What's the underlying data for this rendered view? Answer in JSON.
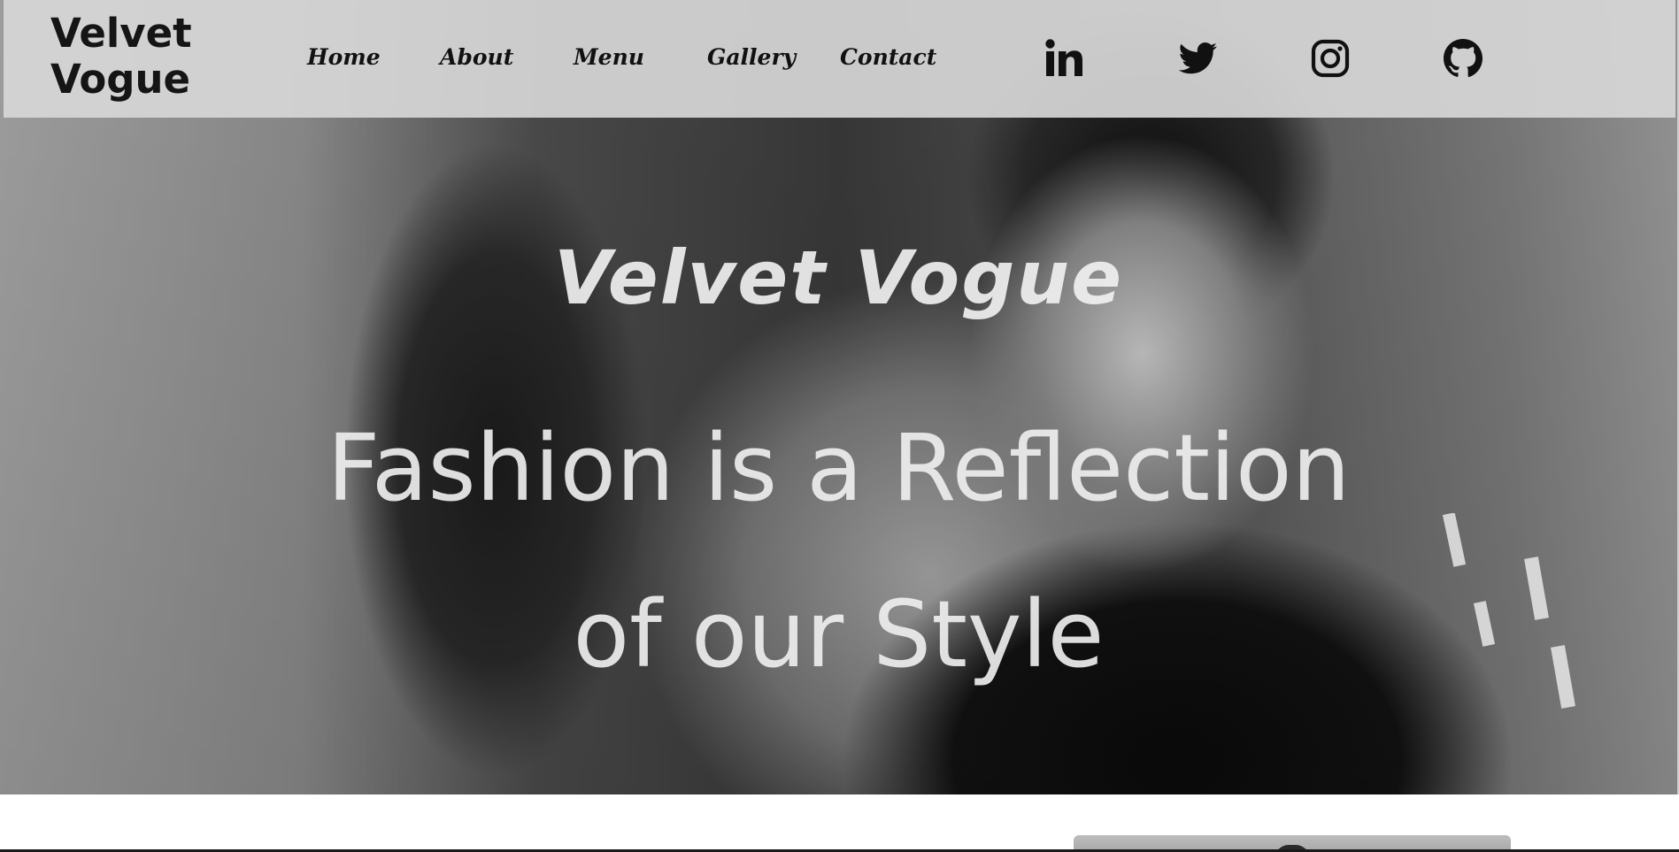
{
  "brand": {
    "logo_line1": "Velvet",
    "logo_line2": "Vogue"
  },
  "nav": {
    "items": [
      {
        "label": "Home"
      },
      {
        "label": "About"
      },
      {
        "label": "Menu"
      },
      {
        "label": "Gallery"
      },
      {
        "label": "Contact"
      }
    ]
  },
  "social": {
    "items": [
      {
        "icon": "linkedin-icon"
      },
      {
        "icon": "twitter-icon"
      },
      {
        "icon": "instagram-icon"
      },
      {
        "icon": "github-icon"
      }
    ]
  },
  "hero": {
    "title": "Velvet Vogue",
    "tagline_line1": "Fashion is a Reflection",
    "tagline_line2": "of our Style"
  },
  "colors": {
    "nav_background": "#d7d7d7",
    "text_dark": "#111111",
    "hero_text": "#eeeeee"
  }
}
